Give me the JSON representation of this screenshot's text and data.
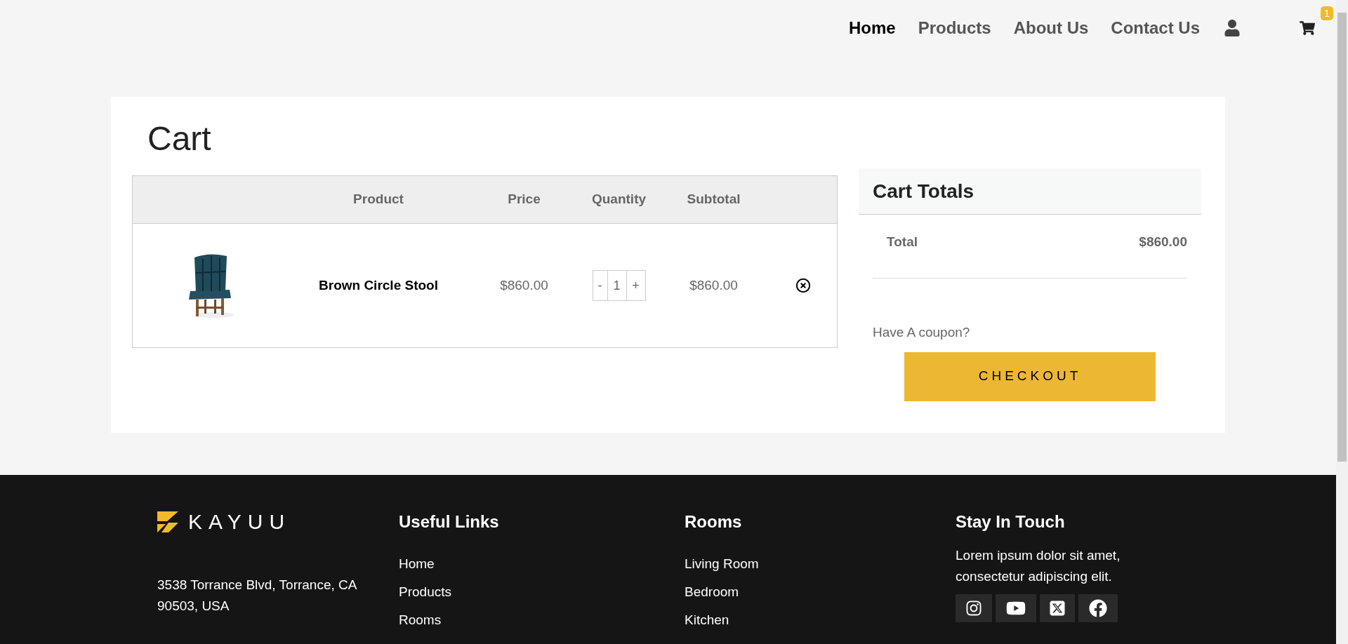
{
  "nav": {
    "links": [
      {
        "label": "Home",
        "selected": true
      },
      {
        "label": "Products",
        "selected": false
      },
      {
        "label": "About Us",
        "selected": false
      },
      {
        "label": "Contact Us",
        "selected": false
      }
    ],
    "cart_count": "1"
  },
  "page_title": "Cart",
  "table": {
    "columns": [
      "Product",
      "Price",
      "Quantity",
      "Subtotal"
    ],
    "rows": [
      {
        "product": "Brown Circle Stool",
        "price": "$860.00",
        "decrement": "-",
        "quantity": "1",
        "increment": "+",
        "subtotal": "$860.00"
      }
    ]
  },
  "totals": {
    "title": "Cart Totals",
    "label": "Total",
    "value": "$860.00",
    "coupon": "Have A coupon?",
    "button": "CHECKOUT"
  },
  "footer": {
    "logo": "KAYUU",
    "address": "3538 Torrance Blvd, Torrance, CA 90503, USA",
    "columns": [
      {
        "title": "Useful Links",
        "links": [
          "Home",
          "Products",
          "Rooms"
        ]
      },
      {
        "title": "Rooms",
        "links": [
          "Living Room",
          "Bedroom",
          "Kitchen"
        ]
      }
    ],
    "contact": {
      "title": "Stay In Touch",
      "text": "Lorem ipsum dolor sit amet, consectetur adipiscing elit."
    }
  }
}
